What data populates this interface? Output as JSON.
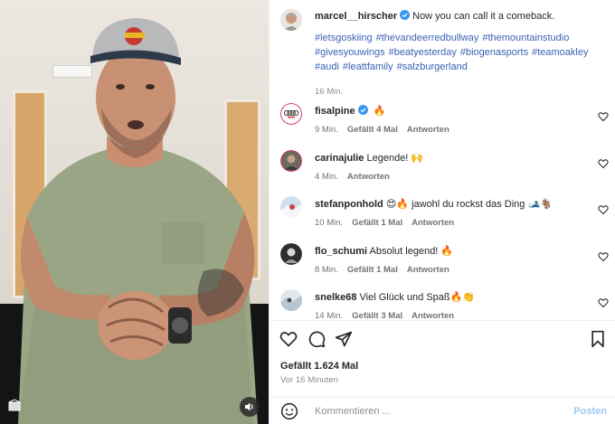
{
  "post": {
    "author": "marcel__hirscher",
    "caption": "Now you can call it a comeback.",
    "hashtags": [
      "#letsgoskiing",
      "#thevandeerredbullway",
      "#themountainstudio",
      "#givesyouwings",
      "#beatyesterday",
      "#biogenasports",
      "#teamoakley",
      "#audi",
      "#leattfamily",
      "#salzburgerland"
    ],
    "time": "16 Min."
  },
  "comments": [
    {
      "user": "fisalpine",
      "verified": true,
      "text": "🔥",
      "time": "9 Min.",
      "likes": "Gefällt 4 Mal",
      "reply": "Antworten"
    },
    {
      "user": "carinajulie",
      "verified": false,
      "text": "Legende! 🙌",
      "time": "4 Min.",
      "likes": "",
      "reply": "Antworten"
    },
    {
      "user": "stefanponhold",
      "verified": false,
      "text": "😍🔥 jawohl du rockst das Ding 🎿🐐",
      "time": "10 Min.",
      "likes": "Gefällt 1 Mal",
      "reply": "Antworten"
    },
    {
      "user": "flo_schumi",
      "verified": false,
      "text": "Absolut legend! 🔥",
      "time": "8 Min.",
      "likes": "Gefällt 1 Mal",
      "reply": "Antworten"
    },
    {
      "user": "snelke68",
      "verified": false,
      "text": "Viel Glück und Spaß🔥👏",
      "time": "14 Min.",
      "likes": "Gefällt 3 Mal",
      "reply": "Antworten"
    }
  ],
  "actions": {
    "likes": "Gefällt 1.624 Mal",
    "when": "Vor 16 Minuten"
  },
  "composer": {
    "placeholder": "Kommentieren ...",
    "post_label": "Posten"
  },
  "colors": {
    "link": "#3b63b4",
    "verified": "#3897f0",
    "post_button_disabled": "#9ec9f4"
  },
  "icons": [
    "volume-icon",
    "verified-badge-icon",
    "heart-icon",
    "comment-icon",
    "share-icon",
    "bookmark-icon",
    "emoji-icon"
  ]
}
